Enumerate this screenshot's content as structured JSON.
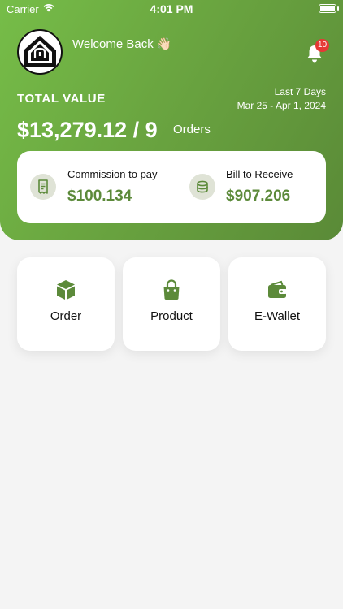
{
  "status_bar": {
    "carrier": "Carrier",
    "time": "4:01 PM"
  },
  "header": {
    "welcome": "Welcome Back 👋🏻",
    "notification_count": "10",
    "total_label": "TOTAL VALUE",
    "period_label": "Last 7 Days",
    "period_range": "Mar 25 - Apr 1, 2024",
    "total_amount": "$13,279.12 / 9",
    "orders_label": "Orders"
  },
  "summary": {
    "commission_title": "Commission to pay",
    "commission_value": "$100.134",
    "bill_title": "Bill to Receive",
    "bill_value": "$907.206"
  },
  "tiles": [
    {
      "label": "Order",
      "icon": "box-icon"
    },
    {
      "label": "Product",
      "icon": "shopping-bag-icon"
    },
    {
      "label": "E-Wallet",
      "icon": "wallet-icon"
    }
  ],
  "colors": {
    "brand_green": "#6aa540",
    "dark_green": "#5c8a3a",
    "badge_red": "#e53935"
  }
}
